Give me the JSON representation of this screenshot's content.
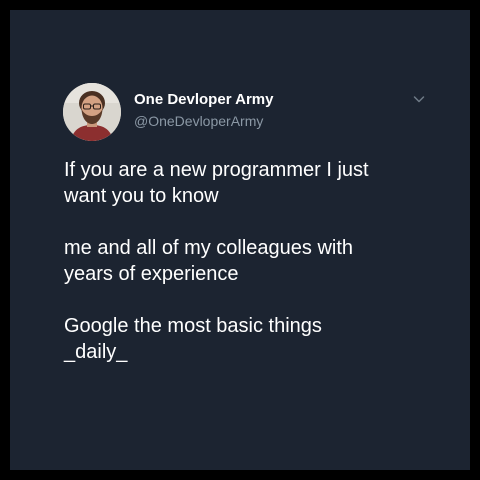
{
  "author": {
    "display_name": "One Devloper Army",
    "handle": "@OneDevloperArmy",
    "avatar_icon": "profile-photo"
  },
  "menu": {
    "icon": "chevron-down-icon"
  },
  "tweet": {
    "paragraphs": [
      "If you are a new programmer I just\nwant you to know",
      "me and all of my colleagues with\nyears of experience",
      "Google the most basic things\n_daily_"
    ]
  },
  "colors": {
    "background": "#1c2431",
    "frame": "#000000",
    "text": "#ffffff",
    "secondary": "#8b98a5"
  }
}
